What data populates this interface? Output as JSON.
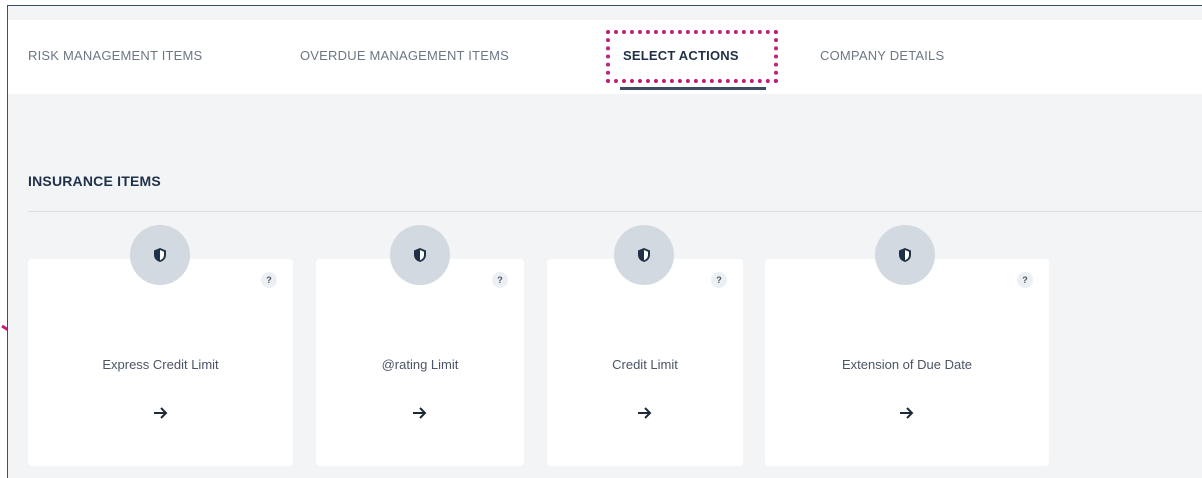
{
  "tabs": [
    {
      "label": "RISK MANAGEMENT ITEMS"
    },
    {
      "label": "OVERDUE MANAGEMENT ITEMS"
    },
    {
      "label": "SELECT ACTIONS",
      "active": true
    },
    {
      "label": "COMPANY DETAILS"
    }
  ],
  "section": {
    "title": "INSURANCE ITEMS"
  },
  "cards": [
    {
      "label": "Express Credit Limit",
      "help": "?",
      "icon": "shield-icon",
      "action_icon": "arrow-right-icon"
    },
    {
      "label": "@rating Limit",
      "help": "?",
      "icon": "shield-icon",
      "action_icon": "arrow-right-icon"
    },
    {
      "label": "Credit Limit",
      "help": "?",
      "icon": "shield-icon",
      "action_icon": "arrow-right-icon"
    },
    {
      "label": "Extension of Due Date",
      "help": "?",
      "icon": "shield-icon",
      "action_icon": "arrow-right-icon"
    }
  ],
  "colors": {
    "highlight": "#c0207a",
    "active_tab": "#1f3148",
    "background": "#f3f4f6"
  }
}
